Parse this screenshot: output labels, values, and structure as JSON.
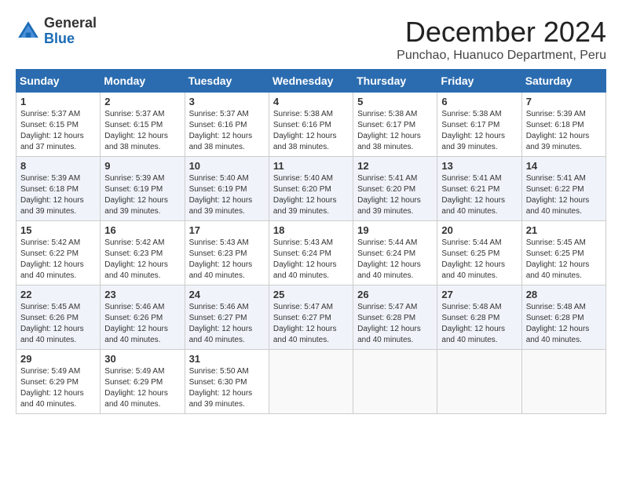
{
  "header": {
    "logo_general": "General",
    "logo_blue": "Blue",
    "title": "December 2024",
    "subtitle": "Punchao, Huanuco Department, Peru"
  },
  "weekdays": [
    "Sunday",
    "Monday",
    "Tuesday",
    "Wednesday",
    "Thursday",
    "Friday",
    "Saturday"
  ],
  "weeks": [
    [
      {
        "day": 1,
        "info": "Sunrise: 5:37 AM\nSunset: 6:15 PM\nDaylight: 12 hours\nand 37 minutes."
      },
      {
        "day": 2,
        "info": "Sunrise: 5:37 AM\nSunset: 6:15 PM\nDaylight: 12 hours\nand 38 minutes."
      },
      {
        "day": 3,
        "info": "Sunrise: 5:37 AM\nSunset: 6:16 PM\nDaylight: 12 hours\nand 38 minutes."
      },
      {
        "day": 4,
        "info": "Sunrise: 5:38 AM\nSunset: 6:16 PM\nDaylight: 12 hours\nand 38 minutes."
      },
      {
        "day": 5,
        "info": "Sunrise: 5:38 AM\nSunset: 6:17 PM\nDaylight: 12 hours\nand 38 minutes."
      },
      {
        "day": 6,
        "info": "Sunrise: 5:38 AM\nSunset: 6:17 PM\nDaylight: 12 hours\nand 39 minutes."
      },
      {
        "day": 7,
        "info": "Sunrise: 5:39 AM\nSunset: 6:18 PM\nDaylight: 12 hours\nand 39 minutes."
      }
    ],
    [
      {
        "day": 8,
        "info": "Sunrise: 5:39 AM\nSunset: 6:18 PM\nDaylight: 12 hours\nand 39 minutes."
      },
      {
        "day": 9,
        "info": "Sunrise: 5:39 AM\nSunset: 6:19 PM\nDaylight: 12 hours\nand 39 minutes."
      },
      {
        "day": 10,
        "info": "Sunrise: 5:40 AM\nSunset: 6:19 PM\nDaylight: 12 hours\nand 39 minutes."
      },
      {
        "day": 11,
        "info": "Sunrise: 5:40 AM\nSunset: 6:20 PM\nDaylight: 12 hours\nand 39 minutes."
      },
      {
        "day": 12,
        "info": "Sunrise: 5:41 AM\nSunset: 6:20 PM\nDaylight: 12 hours\nand 39 minutes."
      },
      {
        "day": 13,
        "info": "Sunrise: 5:41 AM\nSunset: 6:21 PM\nDaylight: 12 hours\nand 40 minutes."
      },
      {
        "day": 14,
        "info": "Sunrise: 5:41 AM\nSunset: 6:22 PM\nDaylight: 12 hours\nand 40 minutes."
      }
    ],
    [
      {
        "day": 15,
        "info": "Sunrise: 5:42 AM\nSunset: 6:22 PM\nDaylight: 12 hours\nand 40 minutes."
      },
      {
        "day": 16,
        "info": "Sunrise: 5:42 AM\nSunset: 6:23 PM\nDaylight: 12 hours\nand 40 minutes."
      },
      {
        "day": 17,
        "info": "Sunrise: 5:43 AM\nSunset: 6:23 PM\nDaylight: 12 hours\nand 40 minutes."
      },
      {
        "day": 18,
        "info": "Sunrise: 5:43 AM\nSunset: 6:24 PM\nDaylight: 12 hours\nand 40 minutes."
      },
      {
        "day": 19,
        "info": "Sunrise: 5:44 AM\nSunset: 6:24 PM\nDaylight: 12 hours\nand 40 minutes."
      },
      {
        "day": 20,
        "info": "Sunrise: 5:44 AM\nSunset: 6:25 PM\nDaylight: 12 hours\nand 40 minutes."
      },
      {
        "day": 21,
        "info": "Sunrise: 5:45 AM\nSunset: 6:25 PM\nDaylight: 12 hours\nand 40 minutes."
      }
    ],
    [
      {
        "day": 22,
        "info": "Sunrise: 5:45 AM\nSunset: 6:26 PM\nDaylight: 12 hours\nand 40 minutes."
      },
      {
        "day": 23,
        "info": "Sunrise: 5:46 AM\nSunset: 6:26 PM\nDaylight: 12 hours\nand 40 minutes."
      },
      {
        "day": 24,
        "info": "Sunrise: 5:46 AM\nSunset: 6:27 PM\nDaylight: 12 hours\nand 40 minutes."
      },
      {
        "day": 25,
        "info": "Sunrise: 5:47 AM\nSunset: 6:27 PM\nDaylight: 12 hours\nand 40 minutes."
      },
      {
        "day": 26,
        "info": "Sunrise: 5:47 AM\nSunset: 6:28 PM\nDaylight: 12 hours\nand 40 minutes."
      },
      {
        "day": 27,
        "info": "Sunrise: 5:48 AM\nSunset: 6:28 PM\nDaylight: 12 hours\nand 40 minutes."
      },
      {
        "day": 28,
        "info": "Sunrise: 5:48 AM\nSunset: 6:28 PM\nDaylight: 12 hours\nand 40 minutes."
      }
    ],
    [
      {
        "day": 29,
        "info": "Sunrise: 5:49 AM\nSunset: 6:29 PM\nDaylight: 12 hours\nand 40 minutes."
      },
      {
        "day": 30,
        "info": "Sunrise: 5:49 AM\nSunset: 6:29 PM\nDaylight: 12 hours\nand 40 minutes."
      },
      {
        "day": 31,
        "info": "Sunrise: 5:50 AM\nSunset: 6:30 PM\nDaylight: 12 hours\nand 39 minutes."
      },
      {
        "day": null,
        "info": ""
      },
      {
        "day": null,
        "info": ""
      },
      {
        "day": null,
        "info": ""
      },
      {
        "day": null,
        "info": ""
      }
    ]
  ]
}
